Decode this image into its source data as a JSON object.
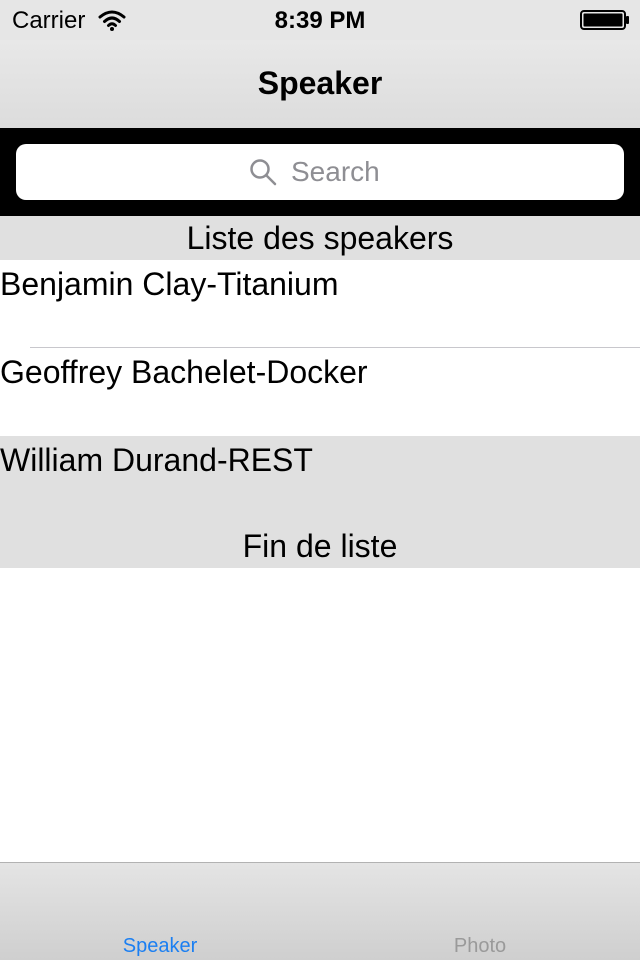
{
  "status_bar": {
    "carrier": "Carrier",
    "time": "8:39 PM"
  },
  "nav": {
    "title": "Speaker"
  },
  "search": {
    "placeholder": "Search"
  },
  "table": {
    "header": "Liste des speakers",
    "footer": "Fin de liste",
    "rows": [
      {
        "label": "Benjamin Clay-Titanium"
      },
      {
        "label": "Geoffrey Bachelet-Docker"
      },
      {
        "label": "William Durand-REST"
      }
    ]
  },
  "tab_bar": {
    "tabs": [
      {
        "label": "Speaker",
        "selected": true
      },
      {
        "label": "Photo",
        "selected": false
      }
    ]
  },
  "colors": {
    "tab_active": "#1b7ff2",
    "tab_inactive": "#9a9a9a",
    "section_background": "#e0e0e0",
    "search_bar_background": "#000000"
  },
  "icons": [
    "wifi-icon",
    "battery-icon",
    "search-icon"
  ]
}
